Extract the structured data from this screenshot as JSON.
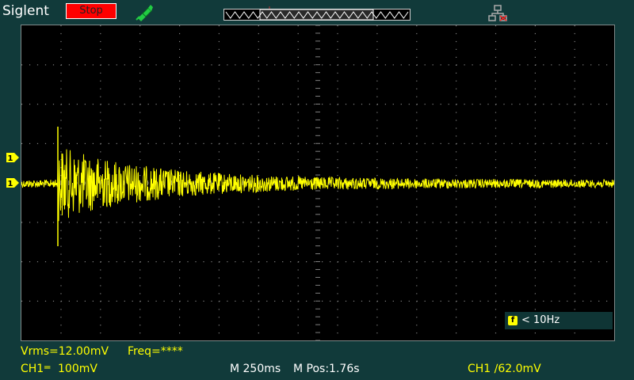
{
  "header": {
    "brand": "Siglent",
    "run_state": "Stop",
    "trigger_letter": "T"
  },
  "icons": {
    "probe": "probe-icon",
    "network": "network-icon",
    "memory": "memory-position-icon",
    "trigger_position": "trigger-position-icon",
    "channel": "channel-level-icon"
  },
  "markers": {
    "channel_label": "1"
  },
  "colors": {
    "background": "#113a3a",
    "trace": "#ffff00",
    "run_stop": "#ff0000",
    "grid": "#808080",
    "probe": "#22cc44"
  },
  "frequency_counter": {
    "text": "< 10Hz"
  },
  "measurements": {
    "vrms": "Vrms=12.00mV",
    "freq": "Freq=****"
  },
  "status": {
    "ch1": "CH1",
    "ch1_coupling": "═",
    "ch1_scale": "100mV",
    "timebase": "M 250ms",
    "mpos": "M Pos:1.76s",
    "trigger": "CH1 ∕62.0mV"
  }
}
